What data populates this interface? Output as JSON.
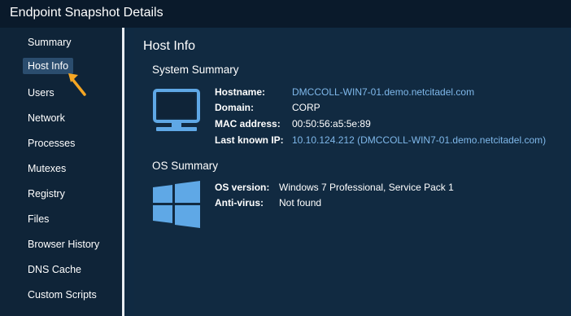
{
  "window": {
    "title": "Endpoint Snapshot Details"
  },
  "sidebar": {
    "items": [
      {
        "label": "Summary"
      },
      {
        "label": "Host Info",
        "active": true
      },
      {
        "label": "Users"
      },
      {
        "label": "Network"
      },
      {
        "label": "Processes"
      },
      {
        "label": "Mutexes"
      },
      {
        "label": "Registry"
      },
      {
        "label": "Files"
      },
      {
        "label": "Browser History"
      },
      {
        "label": "DNS Cache"
      },
      {
        "label": "Custom Scripts"
      }
    ]
  },
  "main": {
    "title": "Host Info",
    "system_summary": {
      "heading": "System Summary",
      "icon": "monitor-icon",
      "fields": [
        {
          "label": "Hostname:",
          "value": "DMCCOLL-WIN7-01.demo.netcitadel.com",
          "link": true
        },
        {
          "label": "Domain:",
          "value": "CORP",
          "link": false
        },
        {
          "label": "MAC address:",
          "value": "00:50:56:a5:5e:89",
          "link": false
        },
        {
          "label": "Last known IP:",
          "value": "10.10.124.212 (DMCCOLL-WIN7-01.demo.netcitadel.com)",
          "link": true
        }
      ]
    },
    "os_summary": {
      "heading": "OS Summary",
      "icon": "windows-logo-icon",
      "fields": [
        {
          "label": "OS version:",
          "value": "Windows 7 Professional, Service Pack 1"
        },
        {
          "label": "Anti-virus:",
          "value": "Not found"
        }
      ]
    }
  },
  "colors": {
    "accent_link": "#7fb8ea",
    "icon_fill": "#5fa8e6",
    "arrow": "#f5a623"
  }
}
